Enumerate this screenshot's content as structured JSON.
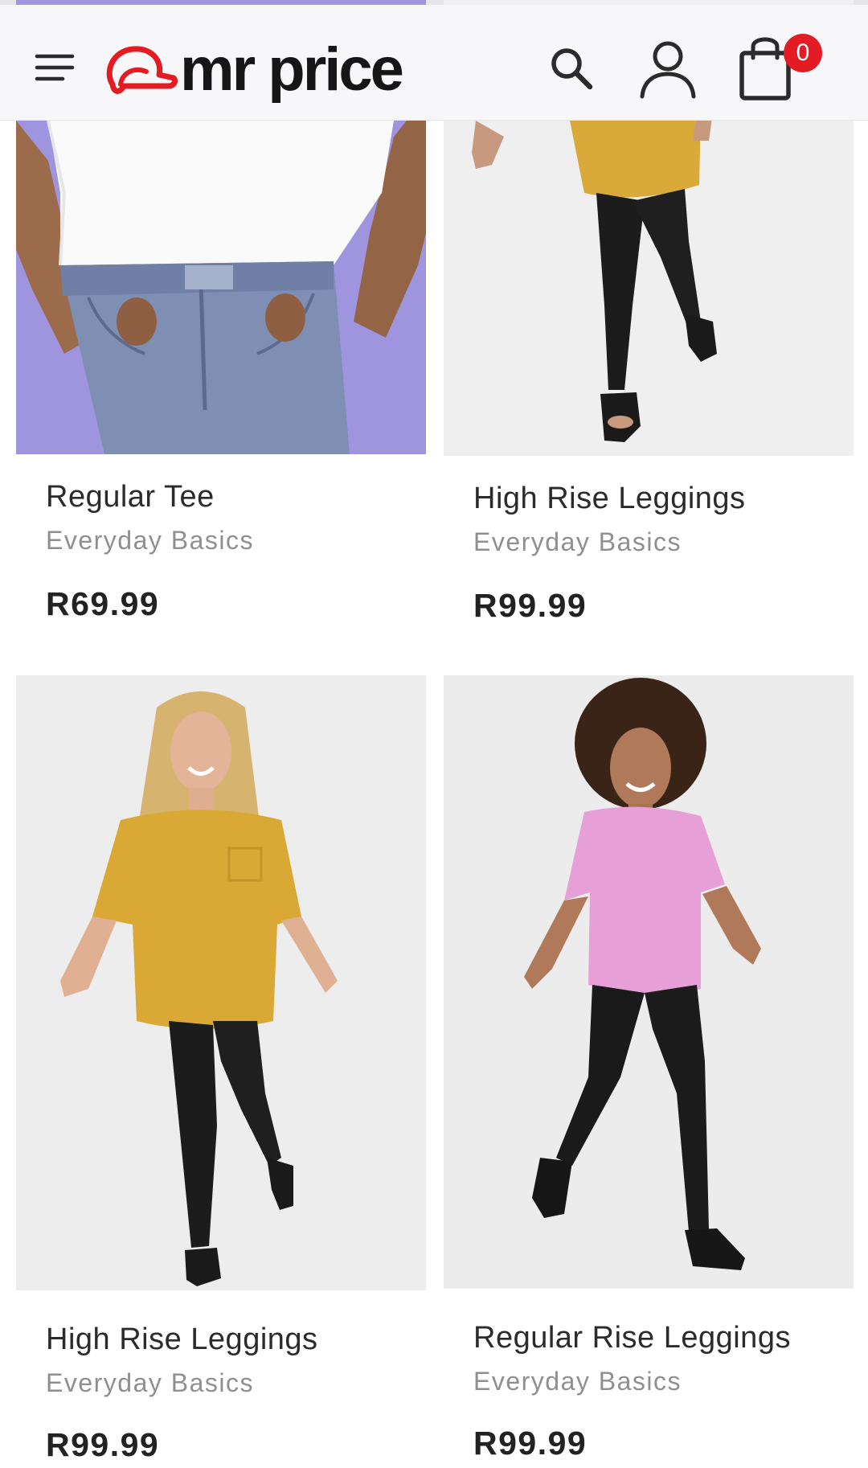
{
  "header": {
    "brand_name": "mr price",
    "cart_count": "0",
    "icons": {
      "menu": "hamburger-menu-icon",
      "search": "search-icon",
      "account": "user-icon",
      "cart": "shopping-bag-icon"
    },
    "colors": {
      "brand_red": "#e31b23",
      "badge_red": "#e31b23"
    }
  },
  "products": [
    {
      "name": "Regular Tee",
      "brand": "Everyday Basics",
      "price": "R69.99",
      "image": "model in white tee and acid-wash jeans on lilac background"
    },
    {
      "name": "High Rise Leggings",
      "brand": "Everyday Basics",
      "price": "R99.99",
      "image": "model in mustard tee and black leggings"
    },
    {
      "name": "High Rise Leggings",
      "brand": "Everyday Basics",
      "price": "R99.99",
      "image": "smiling model in mustard oversized tee and black leggings"
    },
    {
      "name": "Regular Rise Leggings",
      "brand": "Everyday Basics",
      "price": "R99.99",
      "image": "smiling model in pink tee and black leggings"
    }
  ]
}
